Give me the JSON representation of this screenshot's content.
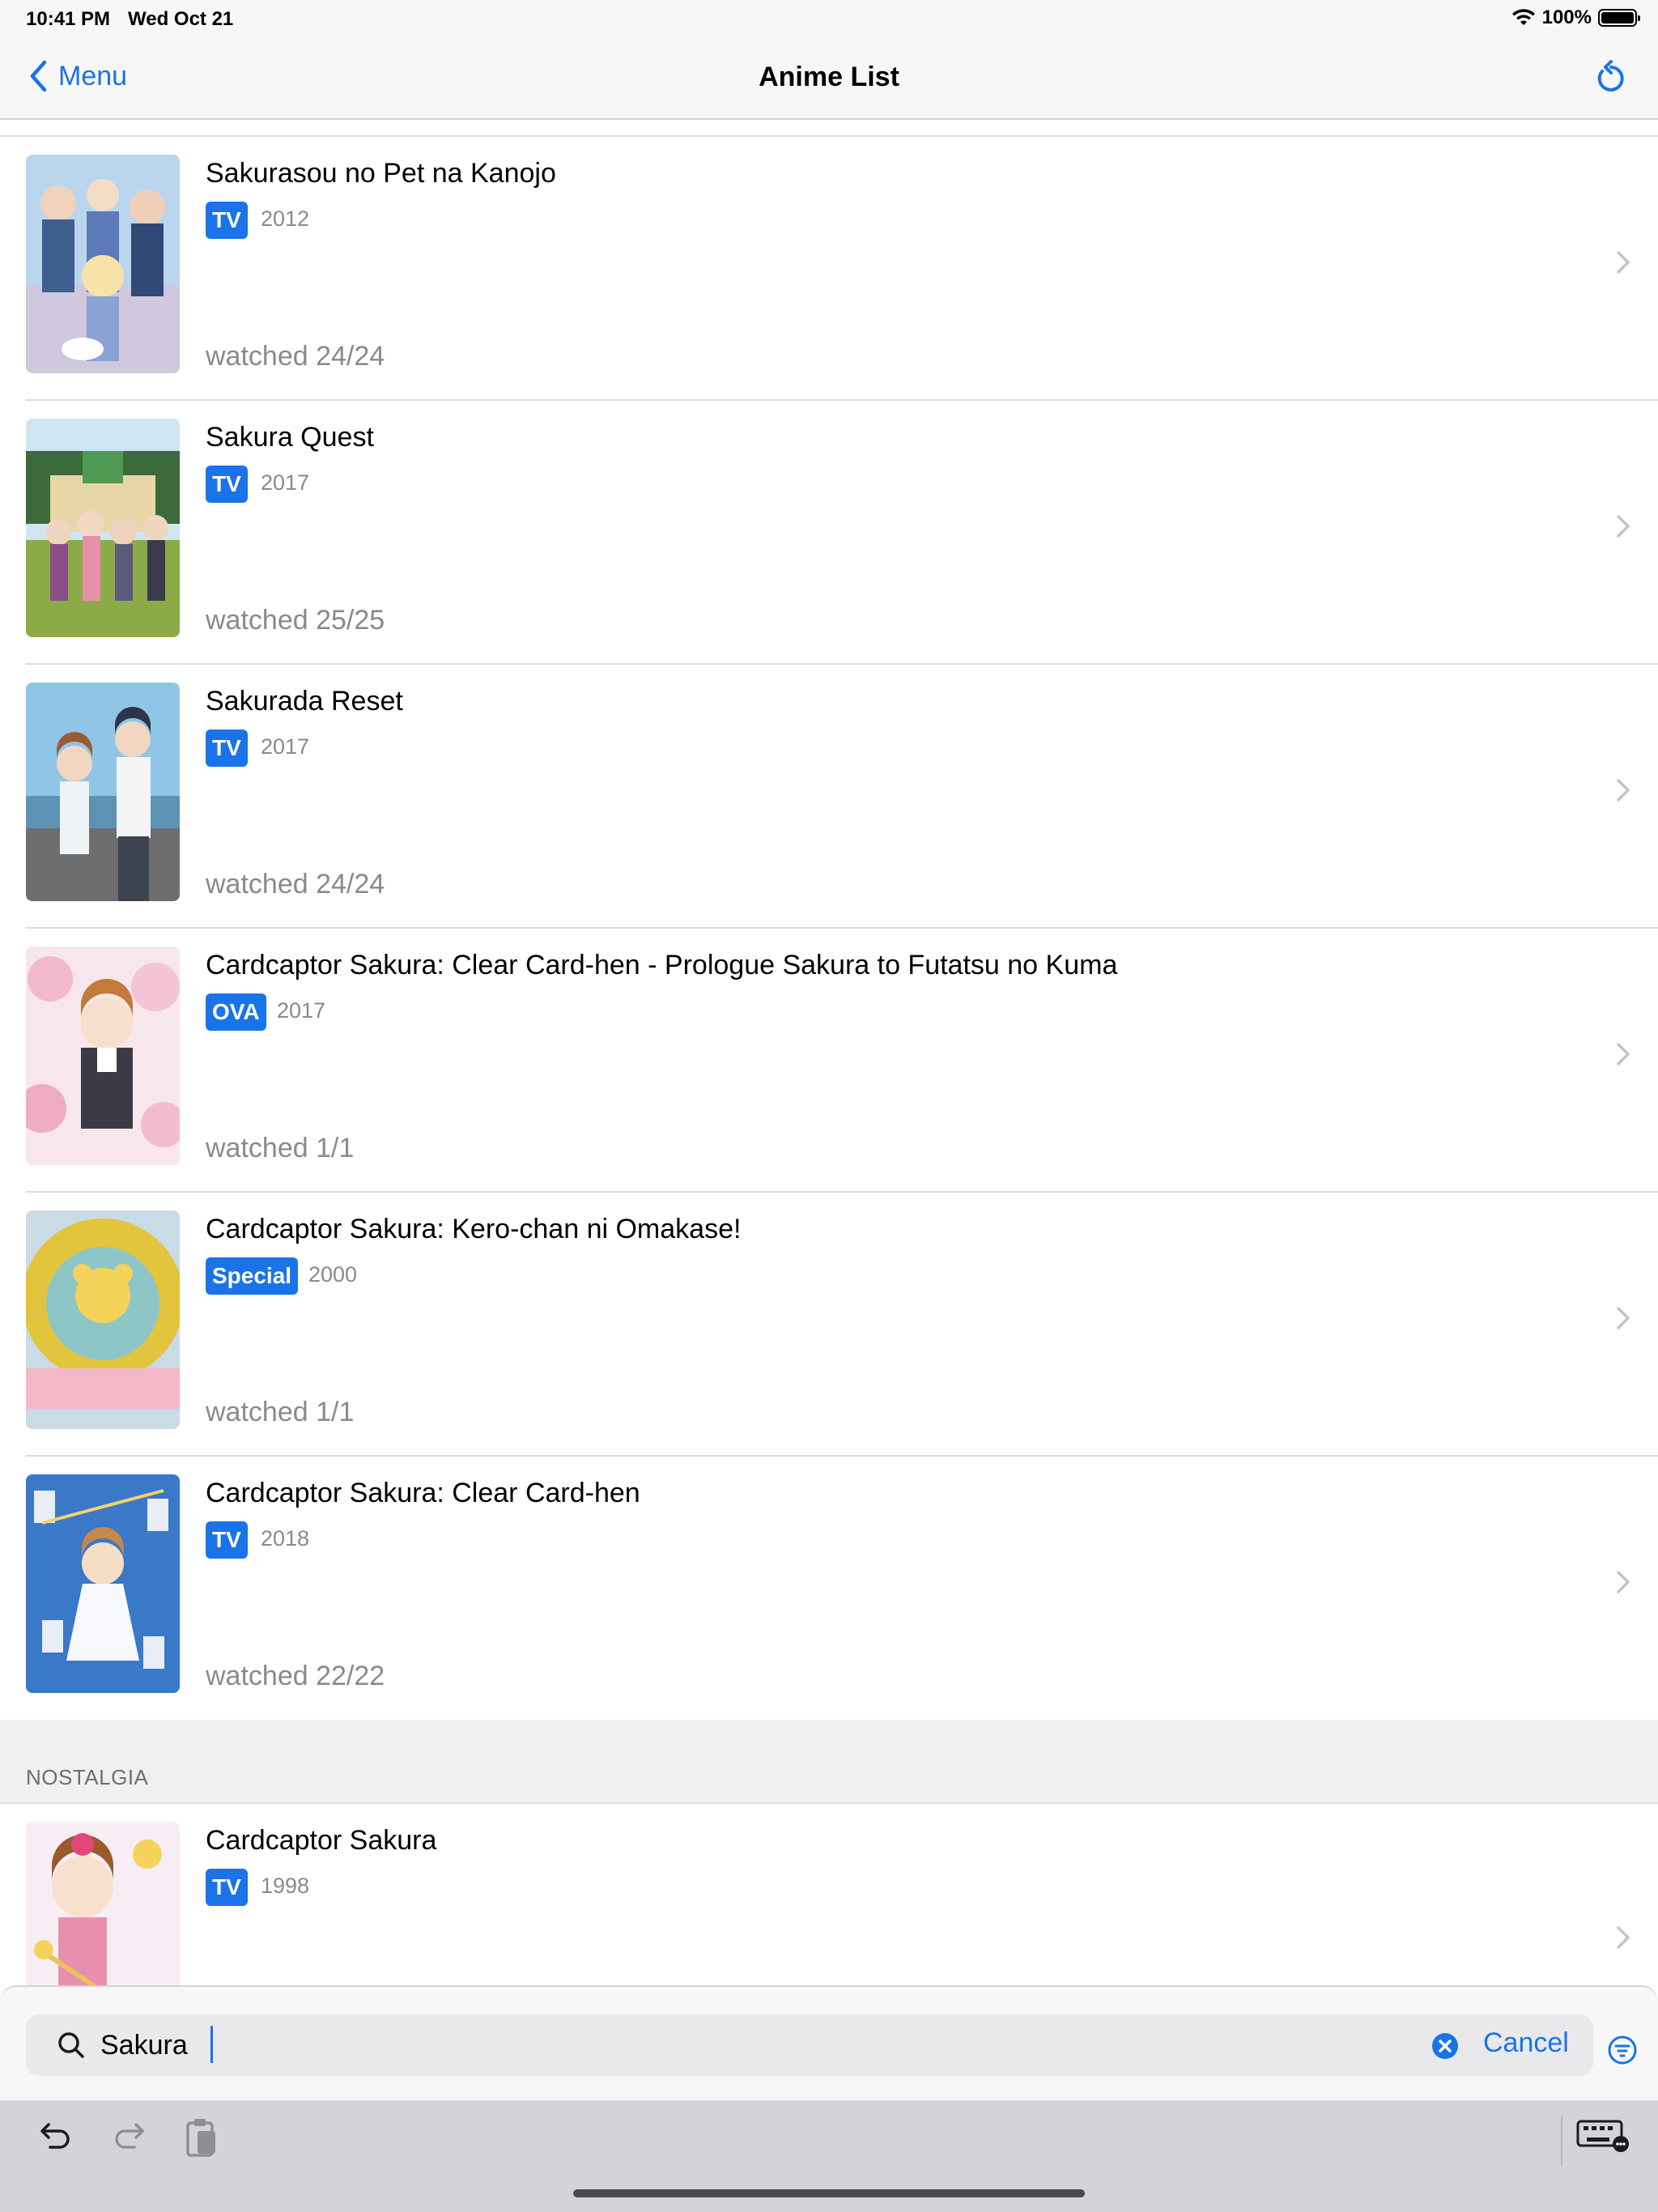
{
  "status_bar": {
    "time": "10:41 PM",
    "date": "Wed Oct 21",
    "battery": "100%"
  },
  "nav": {
    "back_label": "Menu",
    "title": "Anime List"
  },
  "rows": [
    {
      "title": "Sakurasou no Pet na Kanojo",
      "type": "TV",
      "year": "2012",
      "watched": "watched 24/24"
    },
    {
      "title": "Sakura Quest",
      "type": "TV",
      "year": "2017",
      "watched": "watched 25/25"
    },
    {
      "title": "Sakurada Reset",
      "type": "TV",
      "year": "2017",
      "watched": "watched 24/24"
    },
    {
      "title": "Cardcaptor Sakura: Clear Card-hen - Prologue Sakura to Futatsu no Kuma",
      "type": "OVA",
      "year": "2017",
      "watched": "watched 1/1"
    },
    {
      "title": "Cardcaptor Sakura: Kero-chan ni Omakase!",
      "type": "Special",
      "year": "2000",
      "watched": "watched 1/1"
    },
    {
      "title": "Cardcaptor Sakura: Clear Card-hen",
      "type": "TV",
      "year": "2018",
      "watched": "watched 22/22"
    }
  ],
  "section": {
    "header": "NOSTALGIA"
  },
  "section_rows": [
    {
      "title": "Cardcaptor Sakura",
      "type": "TV",
      "year": "1998"
    }
  ],
  "search": {
    "value": "Sakura",
    "cancel_label": "Cancel"
  },
  "colors": {
    "accent": "#1a73e8",
    "secondary_text": "#8a8a8e",
    "separator": "#dcdcdf"
  },
  "icons": [
    "wifi-icon",
    "battery-icon",
    "back-chevron-icon",
    "refresh-icon",
    "chevron-right-icon",
    "search-icon",
    "clear-icon",
    "filter-icon",
    "undo-icon",
    "redo-icon",
    "paste-icon",
    "keyboard-icon"
  ]
}
